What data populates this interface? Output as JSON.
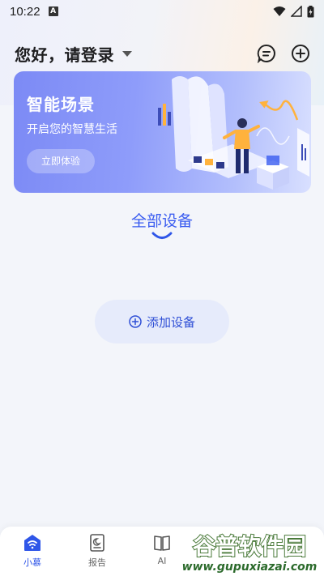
{
  "status_bar": {
    "time": "10:22",
    "notif_icon": "A"
  },
  "header": {
    "title": "您好，请登录"
  },
  "banner": {
    "title": "智能场景",
    "subtitle": "开启您的智慧生活",
    "button_label": "立即体验"
  },
  "section": {
    "title": "全部设备"
  },
  "add_device": {
    "label": "添加设备"
  },
  "bottom_nav": {
    "items": [
      {
        "label": "小慕",
        "icon": "home-wifi-icon",
        "active": true
      },
      {
        "label": "报告",
        "icon": "report-icon",
        "active": false
      },
      {
        "label": "AI",
        "icon": "book-icon",
        "active": false
      }
    ]
  },
  "watermark": {
    "top": "谷普软件园",
    "bottom": "www.gupuxiazai.com"
  },
  "colors": {
    "accent": "#2f56e8",
    "banner_start": "#7c8af5",
    "background": "#f3f5fa"
  }
}
